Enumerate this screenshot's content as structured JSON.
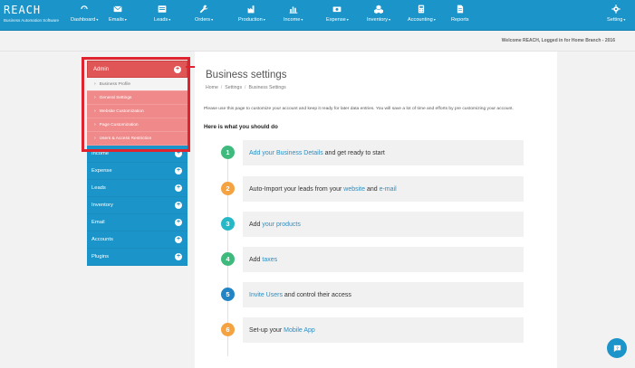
{
  "brand": {
    "name": "REACH",
    "tagline": "Business Automation Software"
  },
  "nav": [
    {
      "key": "dashboard",
      "label": "Dashboard",
      "caret": true,
      "icon": "dashboard-icon"
    },
    {
      "key": "emails",
      "label": "Emails",
      "caret": true,
      "icon": "envelope-icon"
    },
    {
      "key": "leads",
      "label": "Leads",
      "caret": true,
      "icon": "address-card-icon"
    },
    {
      "key": "orders",
      "label": "Orders",
      "caret": true,
      "icon": "wrench-icon"
    },
    {
      "key": "production",
      "label": "Production",
      "caret": true,
      "icon": "factory-icon"
    },
    {
      "key": "income",
      "label": "Income",
      "caret": true,
      "icon": "bar-chart-icon"
    },
    {
      "key": "expense",
      "label": "Expense",
      "caret": true,
      "icon": "money-icon"
    },
    {
      "key": "inventory",
      "label": "Inventory",
      "caret": true,
      "icon": "cubes-icon"
    },
    {
      "key": "accounting",
      "label": "Accounting",
      "caret": true,
      "icon": "calculator-icon"
    },
    {
      "key": "reports",
      "label": "Reports",
      "caret": false,
      "icon": "report-icon"
    },
    {
      "key": "setting",
      "label": "Setting",
      "caret": true,
      "icon": "gear-icon"
    }
  ],
  "caret_glyph": "▾",
  "welcome": "Welcome REACH, Logged in for Home Branch - 2016",
  "sidebar": {
    "admin_label": "Admin",
    "admin_subitems": [
      "Business Profile",
      "General Settings",
      "Website Customization",
      "Page Customization",
      "Users & Access Restriction"
    ],
    "items": [
      "Income",
      "Expense",
      "Leads",
      "Inventory",
      "Email",
      "Accounts",
      "Plugins"
    ],
    "expand_glyph": "+",
    "bullet": "›"
  },
  "annotation": {
    "number": "2"
  },
  "page": {
    "title": "Business settings",
    "breadcrumb": [
      "Home",
      "Settings",
      "Business Settings"
    ],
    "breadcrumb_sep": "/",
    "intro": "Please use this page to customize your account and keep it ready for later data entries. You will save a lot of time and efforts by pre customizing your account.",
    "todo_heading": "Here is what you should do",
    "steps": [
      {
        "num": "1",
        "color": "#3fba7d",
        "parts": [
          {
            "t": "Add your Business Details",
            "link": true
          },
          {
            "t": " and get ready to start",
            "link": false
          }
        ]
      },
      {
        "num": "2",
        "color": "#f4a340",
        "parts": [
          {
            "t": "Auto-Import your leads from your ",
            "link": false
          },
          {
            "t": "website",
            "link": true
          },
          {
            "t": " and ",
            "link": false
          },
          {
            "t": "e-mail",
            "link": true
          }
        ]
      },
      {
        "num": "3",
        "color": "#25b9c8",
        "parts": [
          {
            "t": "Add ",
            "link": false
          },
          {
            "t": "your products",
            "link": true
          }
        ]
      },
      {
        "num": "4",
        "color": "#3fba7d",
        "parts": [
          {
            "t": "Add ",
            "link": false
          },
          {
            "t": "taxes",
            "link": true
          }
        ]
      },
      {
        "num": "5",
        "color": "#2184c4",
        "parts": [
          {
            "t": "Invite Users",
            "link": true
          },
          {
            "t": " and control their access",
            "link": false
          }
        ]
      },
      {
        "num": "6",
        "color": "#f4a340",
        "parts": [
          {
            "t": "Set-up your ",
            "link": false
          },
          {
            "t": "Mobile App",
            "link": true
          }
        ]
      }
    ]
  },
  "colors": {
    "primary": "#1b95c9",
    "admin_red": "#e05555",
    "highlight": "#e0242f",
    "link": "#2a8fc4"
  },
  "help_icon": "chat-help-icon"
}
